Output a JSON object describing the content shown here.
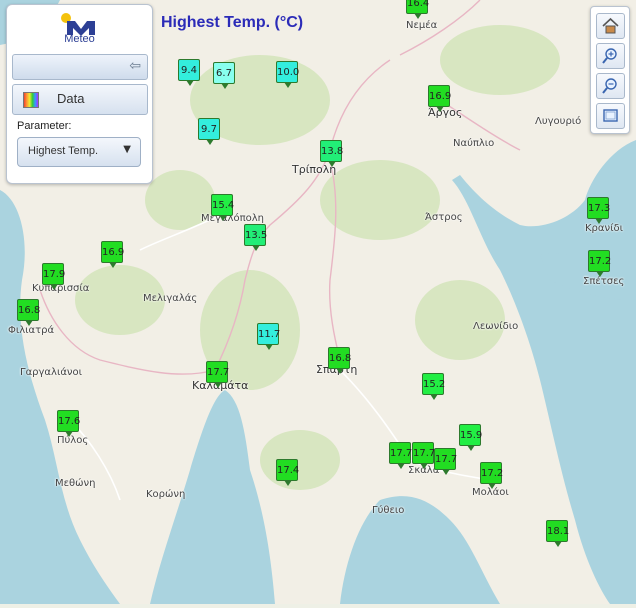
{
  "title": "Highest Temp. (°C)",
  "panel": {
    "logo_text": "Meteo",
    "data_label": "Data",
    "parameter_label": "Parameter:",
    "parameter_value": "Highest Temp."
  },
  "toolbar": {
    "icons": [
      "home-icon",
      "zoom-in-icon",
      "zoom-out-icon",
      "fullscreen-icon"
    ]
  },
  "colors": {
    "title": "#2b2bb8",
    "marker_green": "#22dd22",
    "marker_cyan": "#33eedd",
    "marker_light": "#88ffee"
  },
  "places": [
    {
      "name": "Νεμέα"
    },
    {
      "name": "Άργος"
    },
    {
      "name": "Ναύπλιο"
    },
    {
      "name": "Λυγουριό"
    },
    {
      "name": "Τρίπολη"
    },
    {
      "name": "Μεγαλόπολη"
    },
    {
      "name": "Άστρος"
    },
    {
      "name": "Κρανίδι"
    },
    {
      "name": "Σπέτσες"
    },
    {
      "name": "Κυπαρισσία"
    },
    {
      "name": "Μελιγαλάς"
    },
    {
      "name": "Φιλιατρά"
    },
    {
      "name": "Λεωνίδιο"
    },
    {
      "name": "Γαργαλιάνοι"
    },
    {
      "name": "Σπάρτη"
    },
    {
      "name": "Καλαμάτα"
    },
    {
      "name": "Πύλος"
    },
    {
      "name": "Μεθώνη"
    },
    {
      "name": "Κορώνη"
    },
    {
      "name": "Σκάλα"
    },
    {
      "name": "Μολάοι"
    },
    {
      "name": "Γύθειο"
    }
  ],
  "stations": [
    {
      "value": "16.4",
      "color": "#22dd22"
    },
    {
      "value": "9.4",
      "color": "#33eedd"
    },
    {
      "value": "6.7",
      "color": "#88ffee"
    },
    {
      "value": "10.0",
      "color": "#33eedd"
    },
    {
      "value": "16.9",
      "color": "#22dd22"
    },
    {
      "value": "9.7",
      "color": "#33eedd"
    },
    {
      "value": "13.8",
      "color": "#22ee77"
    },
    {
      "value": "15.4",
      "color": "#22ee44"
    },
    {
      "value": "13.5",
      "color": "#22ee77"
    },
    {
      "value": "17.3",
      "color": "#22dd22"
    },
    {
      "value": "16.9",
      "color": "#22dd22"
    },
    {
      "value": "17.9",
      "color": "#22dd22"
    },
    {
      "value": "17.2",
      "color": "#22dd22"
    },
    {
      "value": "16.8",
      "color": "#22dd22"
    },
    {
      "value": "11.7",
      "color": "#33eedd"
    },
    {
      "value": "16.8",
      "color": "#22dd22"
    },
    {
      "value": "17.7",
      "color": "#22dd22"
    },
    {
      "value": "15.2",
      "color": "#22ee44"
    },
    {
      "value": "17.6",
      "color": "#22dd22"
    },
    {
      "value": "15.9",
      "color": "#22ee44"
    },
    {
      "value": "17.7",
      "color": "#22dd22"
    },
    {
      "value": "17.7",
      "color": "#22dd22"
    },
    {
      "value": "17.7",
      "color": "#22dd22"
    },
    {
      "value": "17.2",
      "color": "#22dd22"
    },
    {
      "value": "17.4",
      "color": "#22dd22"
    },
    {
      "value": "18.1",
      "color": "#22dd22"
    }
  ]
}
